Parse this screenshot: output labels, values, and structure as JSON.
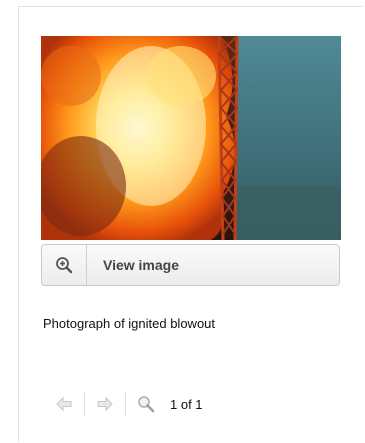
{
  "media": {
    "view_label": "View image",
    "caption": "Photograph of ignited blowout",
    "icons": {
      "zoom": "zoom-in-icon",
      "prev": "arrow-left-icon",
      "next": "arrow-right-icon",
      "search": "magnifier-icon"
    }
  },
  "pager": {
    "count": "1 of 1"
  }
}
